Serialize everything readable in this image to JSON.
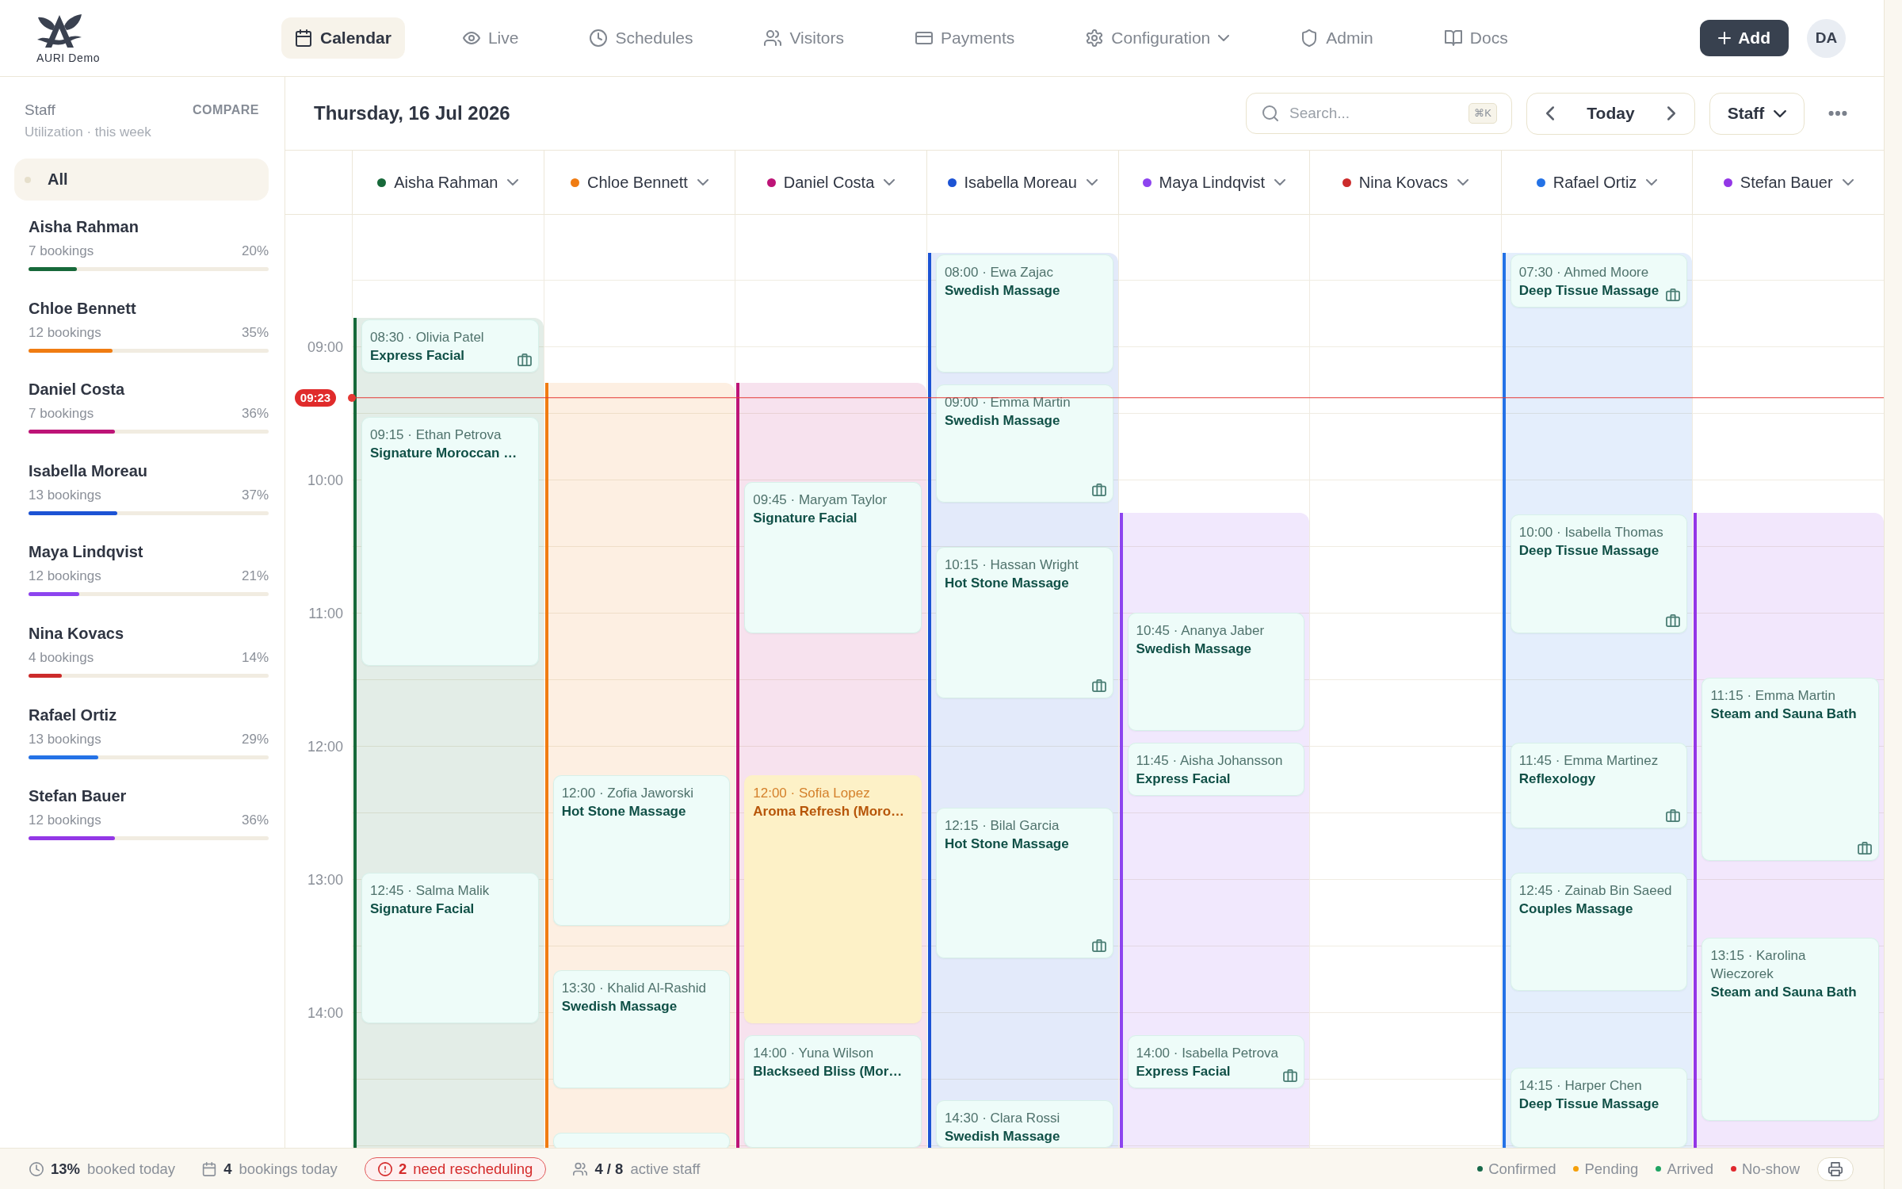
{
  "brand": {
    "name": "AURI Demo"
  },
  "nav": [
    {
      "label": "Calendar",
      "selected": true,
      "dropdown": false
    },
    {
      "label": "Live",
      "selected": false,
      "dropdown": false
    },
    {
      "label": "Schedules",
      "selected": false,
      "dropdown": false
    },
    {
      "label": "Visitors",
      "selected": false,
      "dropdown": false
    },
    {
      "label": "Payments",
      "selected": false,
      "dropdown": false
    },
    {
      "label": "Configuration",
      "selected": false,
      "dropdown": true
    },
    {
      "label": "Admin",
      "selected": false,
      "dropdown": false
    },
    {
      "label": "Docs",
      "selected": false,
      "dropdown": false
    }
  ],
  "add_button": {
    "label": "Add"
  },
  "user": {
    "initials": "DA"
  },
  "sidebar": {
    "title": "Staff",
    "action": "COMPARE",
    "subtitle": "Utilization · this week",
    "all": {
      "label": "All",
      "selected": true
    },
    "staff": [
      {
        "name": "Aisha Rahman",
        "bookings": "7 bookings",
        "percent": "20%",
        "level": 0.2,
        "color": "#17693a"
      },
      {
        "name": "Chloe Bennett",
        "bookings": "12 bookings",
        "percent": "35%",
        "level": 0.35,
        "color": "#f07c12"
      },
      {
        "name": "Daniel Costa",
        "bookings": "7 bookings",
        "percent": "36%",
        "level": 0.36,
        "color": "#bd1477"
      },
      {
        "name": "Isabella Moreau",
        "bookings": "13 bookings",
        "percent": "37%",
        "level": 0.37,
        "color": "#1c53d4"
      },
      {
        "name": "Maya Lindqvist",
        "bookings": "12 bookings",
        "percent": "21%",
        "level": 0.21,
        "color": "#8d44ef"
      },
      {
        "name": "Nina Kovacs",
        "bookings": "4 bookings",
        "percent": "14%",
        "level": 0.14,
        "color": "#cc2b2b"
      },
      {
        "name": "Rafael Ortiz",
        "bookings": "13 bookings",
        "percent": "29%",
        "level": 0.29,
        "color": "#2472e6"
      },
      {
        "name": "Stefan Bauer",
        "bookings": "12 bookings",
        "percent": "36%",
        "level": 0.36,
        "color": "#9337e6"
      }
    ]
  },
  "calendar": {
    "date": "Thursday, 16 Jul 2026",
    "search": {
      "placeholder": "Search...",
      "shortcut": "⌘K"
    },
    "today_button": "Today",
    "view": "Staff",
    "time_labels": [
      "09:00",
      "10:00",
      "11:00",
      "12:00",
      "13:00",
      "14:00"
    ],
    "now": "09:23",
    "columns": [
      {
        "name": "Aisha Rahman",
        "color": "#17693a",
        "events": [
          {
            "line": "08:30 · Olivia Patel",
            "service": "Express Facial",
            "pending": false,
            "briefcase": true
          },
          {
            "line": "09:15 · Ethan Petrova",
            "service": "Signature Moroccan …",
            "pending": false,
            "briefcase": false
          },
          {
            "line": "12:45 · Salma Malik",
            "service": "Signature Facial",
            "pending": false,
            "briefcase": false
          }
        ]
      },
      {
        "name": "Chloe Bennett",
        "color": "#f07c12",
        "events": [
          {
            "line": "12:00 · Zofia Jaworski",
            "service": "Hot Stone Massage",
            "pending": false,
            "briefcase": false
          },
          {
            "line": "13:30 · Khalid Al-Rashid",
            "service": "Swedish Massage",
            "pending": false,
            "briefcase": false
          },
          {
            "pending": false
          }
        ]
      },
      {
        "name": "Daniel Costa",
        "color": "#bd1477",
        "events": [
          {
            "line": "09:45 · Maryam Taylor",
            "service": "Signature Facial",
            "pending": false,
            "briefcase": false
          },
          {
            "line": "12:00 · Sofia Lopez",
            "service": "Aroma Refresh (Moro…",
            "pending": true,
            "briefcase": false
          },
          {
            "line": "14:00 · Yuna Wilson",
            "service": "Blackseed Bliss (Mor…",
            "pending": false,
            "briefcase": false
          }
        ]
      },
      {
        "name": "Isabella Moreau",
        "color": "#1c53d4",
        "events": [
          {
            "line": "08:00 · Ewa Zajac",
            "service": "Swedish Massage",
            "pending": false,
            "briefcase": false
          },
          {
            "line": "09:00 · Emma Martin",
            "service": "Swedish Massage",
            "pending": false,
            "briefcase": true
          },
          {
            "line": "10:15 · Hassan Wright",
            "service": "Hot Stone Massage",
            "pending": false,
            "briefcase": true
          },
          {
            "line": "12:15 · Bilal Garcia",
            "service": "Hot Stone Massage",
            "pending": false,
            "briefcase": true
          },
          {
            "line": "14:30 · Clara Rossi",
            "service": "Swedish Massage",
            "pending": false,
            "briefcase": false
          }
        ]
      },
      {
        "name": "Maya Lindqvist",
        "color": "#8d44ef",
        "events": [
          {
            "line": "10:45 · Ananya Jaber",
            "service": "Swedish Massage",
            "pending": false,
            "briefcase": false
          },
          {
            "line": "11:45 · Aisha Johansson",
            "service": "Express Facial",
            "pending": false,
            "briefcase": false
          },
          {
            "line": "14:00 · Isabella Petrova",
            "service": "Express Facial",
            "pending": false,
            "briefcase": true
          }
        ]
      },
      {
        "name": "Nina Kovacs",
        "color": "#cc2b2b"
      },
      {
        "name": "Rafael Ortiz",
        "color": "#2472e6",
        "events": [
          {
            "line": "07:30 · Ahmed Moore",
            "service": "Deep Tissue Massage",
            "pending": false,
            "briefcase": true
          },
          {
            "line": "10:00 · Isabella Thomas",
            "service": "Deep Tissue Massage",
            "pending": false,
            "briefcase": true
          },
          {
            "line": "11:45 · Emma Martinez",
            "service": "Reflexology",
            "pending": false,
            "briefcase": true
          },
          {
            "line": "12:45 · Zainab Bin Saeed",
            "service": "Couples Massage",
            "pending": false,
            "briefcase": false
          },
          {
            "line": "14:15 · Harper Chen",
            "service": "Deep Tissue Massage",
            "pending": false,
            "briefcase": false
          }
        ]
      },
      {
        "name": "Stefan Bauer",
        "color": "#9337e6",
        "events": [
          {
            "line": "11:15 · Emma Martin",
            "service": "Steam and Sauna Bath",
            "pending": false,
            "briefcase": true
          },
          {
            "line": "13:15 · Karolina Wieczorek",
            "service": "Steam and Sauna Bath",
            "pending": false,
            "briefcase": false
          }
        ]
      }
    ]
  },
  "status_bar": {
    "stats": [
      {
        "kind": "plain",
        "value": "13%",
        "label": "booked today"
      },
      {
        "kind": "plain",
        "value": "4",
        "label": "bookings today"
      },
      {
        "kind": "alert",
        "value": "2",
        "label": "need rescheduling"
      },
      {
        "kind": "plain",
        "value": "4 / 8",
        "label": "active staff"
      }
    ],
    "legend": [
      {
        "label": "Confirmed",
        "color": "#17694a"
      },
      {
        "label": "Pending",
        "color": "#f5a00b"
      },
      {
        "label": "Arrived",
        "color": "#1fa463"
      },
      {
        "label": "No-show",
        "color": "#e0282e"
      }
    ]
  }
}
